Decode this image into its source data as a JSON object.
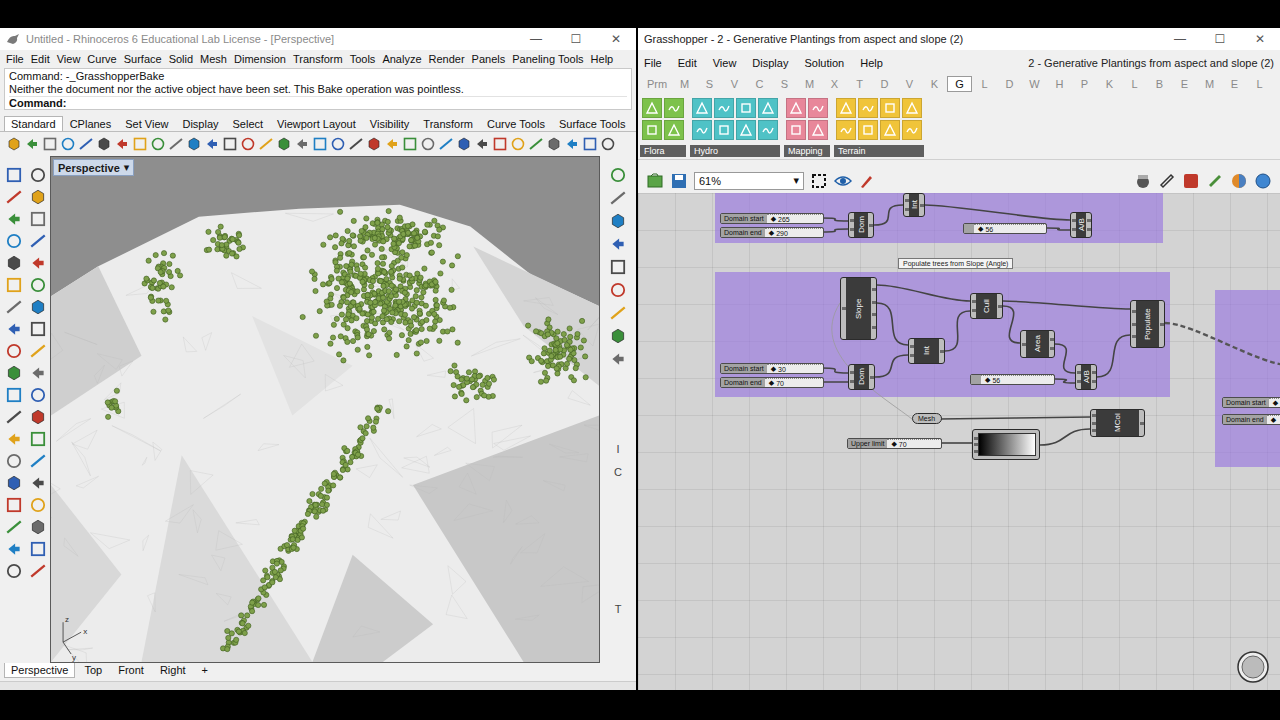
{
  "rhino": {
    "title": "Untitled - Rhinoceros 6 Educational Lab License - [Perspective]",
    "window_controls": [
      "—",
      "☐",
      "✕"
    ],
    "menu": [
      "File",
      "Edit",
      "View",
      "Curve",
      "Surface",
      "Solid",
      "Mesh",
      "Dimension",
      "Transform",
      "Tools",
      "Analyze",
      "Render",
      "Panels",
      "Paneling Tools",
      "Help"
    ],
    "command_history": [
      "Command: -_GrasshopperBake",
      "Neither the document nor the active object have been set. This Bake operation was pointless."
    ],
    "command_prompt": "Command:",
    "toolbar_tabs": [
      {
        "label": "Standard",
        "selected": true
      },
      {
        "label": "CPlanes",
        "selected": false
      },
      {
        "label": "Set View",
        "selected": false
      },
      {
        "label": "Display",
        "selected": false
      },
      {
        "label": "Select",
        "selected": false
      },
      {
        "label": "Viewport Layout",
        "selected": false
      },
      {
        "label": "Visibility",
        "selected": false
      },
      {
        "label": "Transform",
        "selected": false
      },
      {
        "label": "Curve Tools",
        "selected": false
      },
      {
        "label": "Surface Tools",
        "selected": false
      }
    ],
    "viewport": {
      "label": "Perspective",
      "menu_arrow": "▾",
      "axis": [
        "x",
        "y",
        "z"
      ]
    },
    "side_marks": [
      "I",
      "C",
      "T"
    ],
    "viewport_tabs": [
      {
        "label": "Perspective",
        "selected": true
      },
      {
        "label": "Top",
        "selected": false
      },
      {
        "label": "Front",
        "selected": false
      },
      {
        "label": "Right",
        "selected": false
      }
    ],
    "add_view": "+"
  },
  "grasshopper": {
    "title": "Grasshopper - 2 - Generative Plantings from aspect and slope (2)",
    "window_controls": [
      "—",
      "☐",
      "✕"
    ],
    "menu": [
      "File",
      "Edit",
      "View",
      "Display",
      "Solution",
      "Help"
    ],
    "document_name": "2 - Generative Plantings from aspect and slope (2)",
    "component_tabs": [
      {
        "label": "Prm",
        "selected": false
      },
      {
        "label": "M",
        "selected": false
      },
      {
        "label": "S",
        "selected": false
      },
      {
        "label": "V",
        "selected": false
      },
      {
        "label": "C",
        "selected": false
      },
      {
        "label": "S",
        "selected": false
      },
      {
        "label": "M",
        "selected": false
      },
      {
        "label": "X",
        "selected": false
      },
      {
        "label": "T",
        "selected": false
      },
      {
        "label": "D",
        "selected": false
      },
      {
        "label": "V",
        "selected": false
      },
      {
        "label": "K",
        "selected": false
      },
      {
        "label": "G",
        "selected": true
      },
      {
        "label": "L",
        "selected": false
      },
      {
        "label": "D",
        "selected": false
      },
      {
        "label": "W",
        "selected": false
      },
      {
        "label": "H",
        "selected": false
      },
      {
        "label": "P",
        "selected": false
      },
      {
        "label": "K",
        "selected": false
      },
      {
        "label": "L",
        "selected": false
      },
      {
        "label": "B",
        "selected": false
      },
      {
        "label": "E",
        "selected": false
      },
      {
        "label": "M",
        "selected": false
      },
      {
        "label": "E",
        "selected": false
      },
      {
        "label": "L",
        "selected": false
      }
    ],
    "ribbon_groups": [
      {
        "label": "Flora",
        "color": "#7dc24b"
      },
      {
        "label": "Hydro",
        "color": "#4fc2c6"
      },
      {
        "label": "Mapping",
        "color": "#e8879a"
      },
      {
        "label": "Terrain",
        "color": "#f0c43a"
      }
    ],
    "zoom": "61%",
    "zoom_arrow": "▾",
    "group_label": "Populate trees from Slope (Angle)",
    "slider_grip": "◆",
    "sliders": [
      {
        "label": "Domain start",
        "value": "265"
      },
      {
        "label": "Domain end",
        "value": "290"
      },
      {
        "label": "",
        "value": "56"
      },
      {
        "label": "Domain start",
        "value": "30"
      },
      {
        "label": "Domain end",
        "value": "70"
      },
      {
        "label": "",
        "value": "56"
      },
      {
        "label": "Upper limit",
        "value": "70"
      },
      {
        "label": "Domain start",
        "value": ""
      },
      {
        "label": "Domain end",
        "value": ""
      }
    ],
    "nodes": [
      {
        "label": "Dom"
      },
      {
        "label": "Int"
      },
      {
        "label": "A/B"
      },
      {
        "label": "Slope"
      },
      {
        "label": "Cull"
      },
      {
        "label": "Int"
      },
      {
        "label": "Area"
      },
      {
        "label": "Dom"
      },
      {
        "label": "A/B"
      },
      {
        "label": "Populate"
      },
      {
        "label": "MCol"
      }
    ],
    "params": [
      {
        "label": "Mesh"
      }
    ]
  }
}
